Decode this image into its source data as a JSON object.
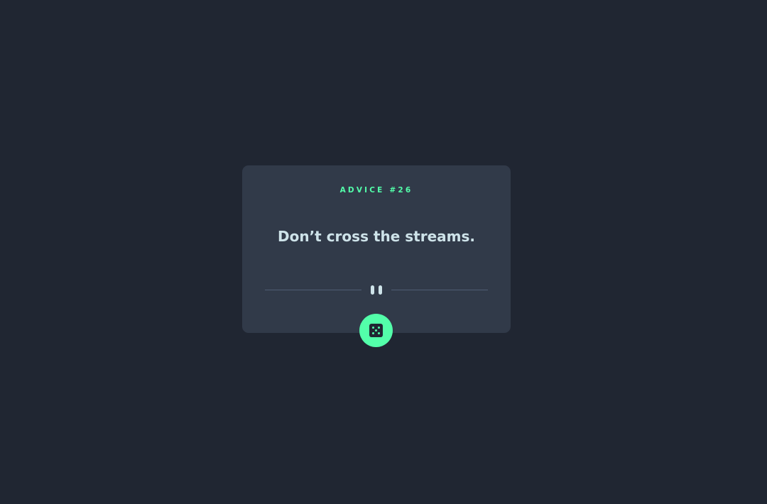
{
  "card": {
    "advice_label": "ADVICE #26",
    "advice_text": "Don’t cross the streams."
  },
  "button": {
    "icon": "dice-icon",
    "accent_color": "#53ffaa"
  },
  "theme": {
    "background": "#202632",
    "card_background": "#313a49",
    "text_color": "#cee3e9"
  }
}
